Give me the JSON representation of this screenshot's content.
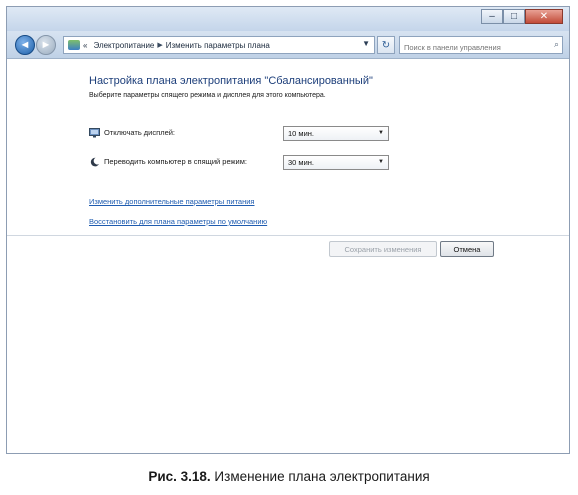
{
  "window": {
    "controls": {
      "minimize": "–",
      "maximize": "□",
      "close": "✕"
    }
  },
  "navbar": {
    "back_icon": "◄",
    "forward_icon": "►",
    "breadcrumb": {
      "overflow": "«",
      "item1": "Электропитание",
      "separator": "▶",
      "item2": "Изменить параметры плана"
    },
    "refresh_icon": "↻",
    "search_placeholder": "Поиск в панели управления",
    "search_icon": "⌕"
  },
  "main": {
    "heading": "Настройка плана электропитания \"Сбалансированный\"",
    "subtitle": "Выберите параметры спящего режима и дисплея для этого компьютера.",
    "rows": [
      {
        "label": "Отключать дисплей:",
        "value": "10 мин."
      },
      {
        "label": "Переводить компьютер в спящий режим:",
        "value": "30 мин."
      }
    ],
    "links": {
      "advanced": "Изменить дополнительные параметры питания",
      "restore": "Восстановить для плана параметры по умолчанию"
    }
  },
  "footer": {
    "save_label": "Сохранить изменения",
    "cancel_label": "Отмена"
  },
  "caption": {
    "prefix": "Рис. 3.18.",
    "text": " Изменение плана электропитания"
  }
}
